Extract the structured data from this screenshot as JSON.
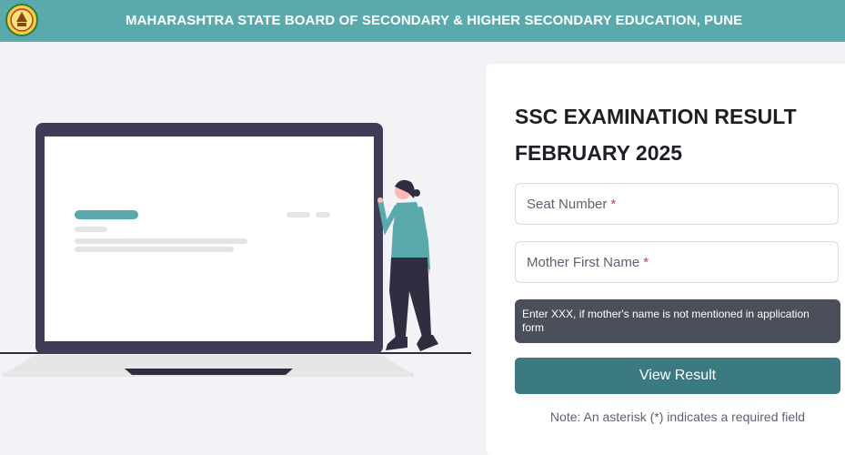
{
  "header": {
    "title": "MAHARASHTRA STATE BOARD OF SECONDARY & HIGHER SECONDARY EDUCATION, PUNE",
    "logo_icon": "board-emblem-icon",
    "background_color": "#5aa9ac"
  },
  "form": {
    "title_line1": "SSC EXAMINATION RESULT",
    "title_line2": "FEBRUARY 2025",
    "seat_number_placeholder": "Seat Number",
    "mother_name_placeholder": "Mother First Name",
    "required_marker": "*",
    "hint_text": "Enter XXX, if mother's name is not mentioned in application form",
    "submit_label": "View Result",
    "note_text": "Note: An asterisk (*) indicates a required field",
    "button_color": "#3b7a80"
  }
}
